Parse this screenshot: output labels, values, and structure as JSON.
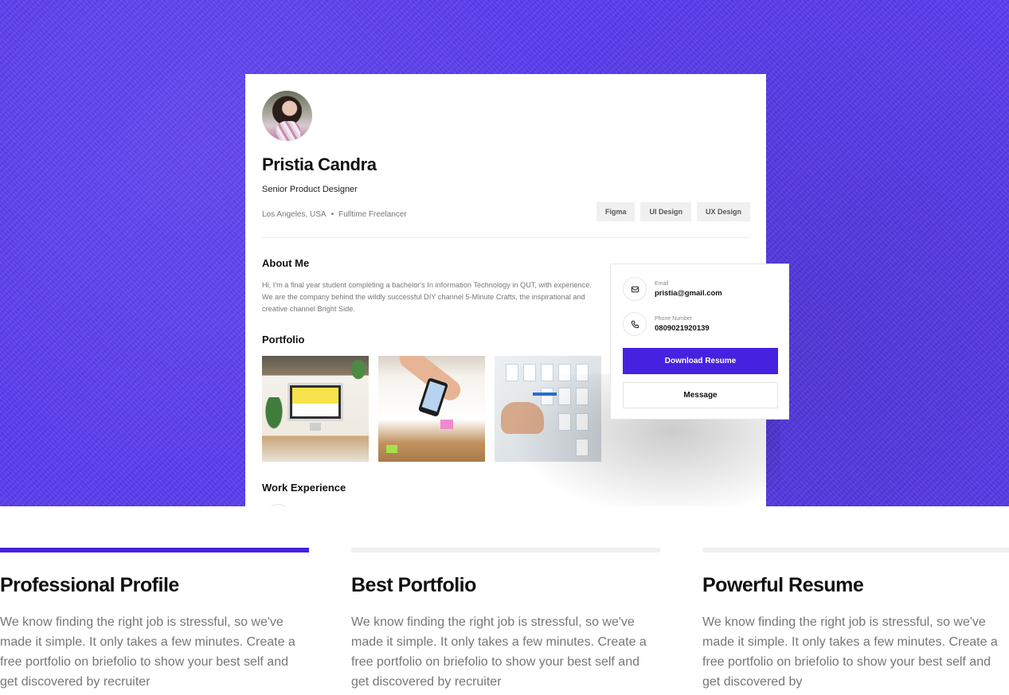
{
  "profile": {
    "name": "Pristia Candra",
    "role": "Senior Product Designer",
    "location": "Los Angeles, USA",
    "separator": "•",
    "employment": "Fulltime Freelancer",
    "tags": [
      "Figma",
      "UI Design",
      "UX Design"
    ],
    "about_heading": "About Me",
    "about_text": "Hi, I'm a final year student completing a bachelor's In information Technology in QUT, with experience. We are the company behind the wildly successful DIY channel 5-Minute Crafts, the inspirational and creative channel Bright Side.",
    "portfolio_heading": "Portfolio",
    "work_heading": "Work Experience"
  },
  "contact": {
    "email_label": "Email",
    "email_value": "pristia@gmail.com",
    "phone_label": "Phone Number",
    "phone_value": "0809021920139",
    "download_label": "Download Resume",
    "message_label": "Message"
  },
  "features": [
    {
      "title": "Professional Profile",
      "description": "We know finding the right job is stressful, so we've made it simple. It only takes a few minutes. Create a free portfolio on briefolio to show your best self and get discovered by recruiter",
      "active": true
    },
    {
      "title": "Best Portfolio",
      "description": "We know finding the right job is stressful, so we've made it simple. It only takes a few minutes. Create a free portfolio on briefolio to show your best self and get discovered by recruiter",
      "active": false
    },
    {
      "title": "Powerful Resume",
      "description": "We know finding the right job is stressful, so we've made it simple. It only takes a few minutes. Create a free portfolio on briefolio to show your best self and get discovered by",
      "active": false
    }
  ],
  "colors": {
    "hero_background": "#5a3cf0",
    "accent": "#4622e0",
    "inactive_bar": "#f1f1f1",
    "muted_text": "#777777"
  },
  "icons": {
    "email": "mail-icon",
    "phone": "phone-icon"
  }
}
